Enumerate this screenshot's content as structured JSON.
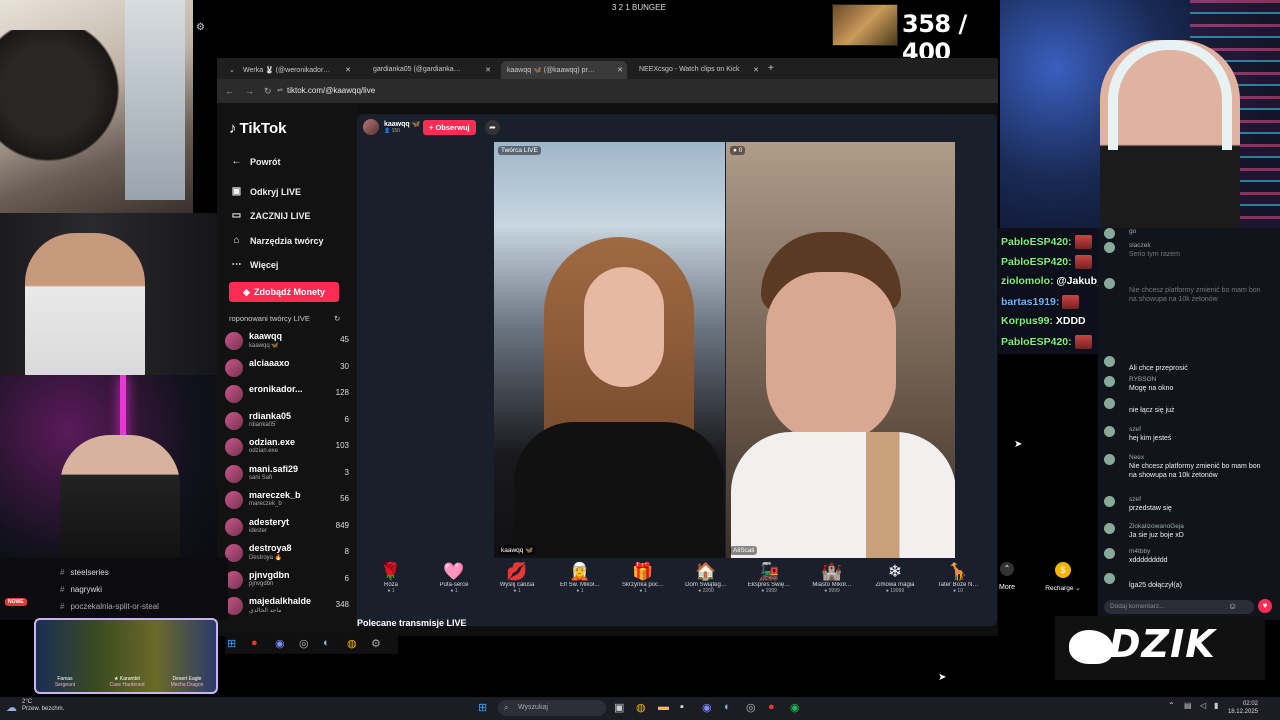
{
  "top_title": "3 2 1 BUNGEE",
  "score": "358 / 400",
  "browser": {
    "tabs": [
      {
        "label": "Werka 🐰 (@weronikador…"
      },
      {
        "label": "gardianka05 (@gardianka…"
      },
      {
        "label": "kaawqq 🦋 (@kaawqq) pr…"
      },
      {
        "label": "NEEXcsgo - Watch clips on Kick"
      }
    ],
    "new_tab": "+",
    "url": "tiktok.com/@kaawqq/live"
  },
  "tiktok": {
    "logo": "TikTok",
    "nav": {
      "back": "Powrót",
      "discover": "Odkryj LIVE",
      "start": "ZACZNIJ LIVE",
      "tools": "Narzędzia twórcy",
      "more": "Więcej"
    },
    "coins_button": "Zdobądź Monety",
    "recommended_header": "roponowani twórcy LIVE",
    "creators": [
      {
        "name": "kaawqq",
        "sub": "kaawqq 🦋",
        "count": "45"
      },
      {
        "name": "alciaaaxo",
        "sub": "",
        "count": "30"
      },
      {
        "name": "eronikador...",
        "sub": "",
        "count": "128"
      },
      {
        "name": "rdianka05",
        "sub": "rdianka05",
        "count": "6"
      },
      {
        "name": "odzian.exe",
        "sub": "odzian.exe",
        "count": "103"
      },
      {
        "name": "mani.safi29",
        "sub": "sani Safi",
        "count": "3"
      },
      {
        "name": "mareczek_b",
        "sub": "mareczek_b",
        "count": "56"
      },
      {
        "name": "adesteryt",
        "sub": "idester",
        "count": "849"
      },
      {
        "name": "destroya8",
        "sub": "Destroya 🔥",
        "count": "8"
      },
      {
        "name": "pjnvgdbn",
        "sub": "pjnvgdbn",
        "count": "6"
      },
      {
        "name": "majedalkhalde",
        "sub": "ماجد الخالدي",
        "count": "348"
      }
    ]
  },
  "live": {
    "host_name": "kaawqq 🦋",
    "host_viewers": "👤 150",
    "follow_label": "+ Obserwuj",
    "creator_label": "Twórca LIVE",
    "guest_badge": "0",
    "left_name": "kaawqq 🦋",
    "right_name": "AliScali",
    "gifts": [
      {
        "icon": "🌹",
        "name": "Róża",
        "price": "1"
      },
      {
        "icon": "🩷",
        "name": "Pufa-serce",
        "price": "1"
      },
      {
        "icon": "💋",
        "name": "Wyślij całusa",
        "price": "1"
      },
      {
        "icon": "🧝",
        "name": "Elf Św. Mikoł…",
        "price": "1"
      },
      {
        "icon": "🎁",
        "name": "Skrzynka poc…",
        "price": "1"
      },
      {
        "icon": "🏠",
        "name": "Dom Świąteg…",
        "price": "2200"
      },
      {
        "icon": "🚂",
        "name": "Ekspres Świę…",
        "price": "1999"
      },
      {
        "icon": "🏰",
        "name": "Miasto Mikoł…",
        "price": "9999"
      },
      {
        "icon": "❄",
        "name": "Zimowa magia",
        "price": "19999"
      },
      {
        "icon": "🦒",
        "name": "Tater Boże N…",
        "price": "10"
      }
    ],
    "more_label": "More",
    "recharge_label": "Recharge",
    "recommended_live": "Polecane transmisje LIVE"
  },
  "overlay_chat": [
    {
      "user": "PabloESP420:",
      "msg": "",
      "emote": true,
      "color": "#7df27a"
    },
    {
      "user": "PabloESP420:",
      "msg": "",
      "emote": true,
      "color": "#7df27a"
    },
    {
      "user": "ziolomolo:",
      "msg": "@Jakub_PRNL to ten kurwa",
      "emote": false,
      "color": "#7df27a"
    },
    {
      "user": "bartas1919:",
      "msg": "",
      "emote": true,
      "color": "#6db6ff"
    },
    {
      "user": "Korpus99:",
      "msg": "XDDD",
      "emote": false,
      "color": "#7df27a"
    },
    {
      "user": "PabloESP420:",
      "msg": "",
      "emote": true,
      "color": "#7df27a"
    }
  ],
  "tiktok_chat": [
    {
      "name": "go",
      "msg": "",
      "dim": true
    },
    {
      "name": "slaczek",
      "msg": "Serio tym razem",
      "dim": true
    },
    {
      "name": "",
      "msg": "Nie chcesz platformy zmienić bo mam bon na showupa na 10k żetonów",
      "dim": true
    },
    {
      "name": "",
      "msg": "Ali chce przeprosić",
      "dim": false
    },
    {
      "name": "RYBSON",
      "msg": "Mogę na okno",
      "dim": false
    },
    {
      "name": "",
      "msg": "nie łącz się już",
      "dim": false
    },
    {
      "name": "szef",
      "msg": "hej kim jesteś",
      "dim": false
    },
    {
      "name": "Neex",
      "msg": "Nie chcesz platformy zmienić bo mam bon na showupa na 10k żetonów",
      "dim": false
    },
    {
      "name": "szef",
      "msg": "przedstaw się",
      "dim": false
    },
    {
      "name": "ZlokalizowanoGeja",
      "msg": "Ja sie juz boje xD",
      "dim": false
    },
    {
      "name": "m4tbby",
      "msg": "xddddddddd",
      "dim": false
    },
    {
      "name": "",
      "msg": "lga25  dołączył(a)",
      "dim": false
    }
  ],
  "comment_placeholder": "Dodaj komentarz...",
  "discord_channels": [
    "steelseries",
    "nagrywki",
    "poczekalnia-split-or-steal"
  ],
  "new_badge": "NOWE",
  "weapons": [
    {
      "name": "Famas",
      "skin": "Sergeant"
    },
    {
      "name": "★ Karambit",
      "skin": "Case Hardened"
    },
    {
      "name": "Desert Eagle",
      "skin": "Mecha Dragon"
    }
  ],
  "dzik": "DZIK",
  "taskbar": {
    "weather_temp": "2°C",
    "weather_desc": "Przew. bezchm.",
    "search_placeholder": "Wyszukaj",
    "time": "02:02",
    "date": "18.12.2025"
  }
}
